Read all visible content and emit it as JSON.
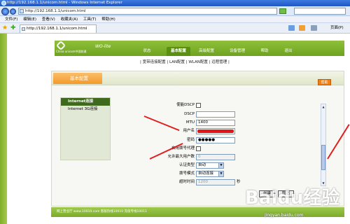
{
  "window": {
    "title": "http://192.168.1.1/unicom.html - Windows Internet Explorer"
  },
  "address": {
    "url": "http://192.168.1.1/unicom.html"
  },
  "menu": [
    "文件(F)",
    "编辑(E)",
    "查看(V)",
    "收藏夹(A)",
    "工具(T)",
    "帮助(H)"
  ],
  "tab": {
    "label": "http://192.168.1.1/unicom.html"
  },
  "toolbar": {
    "page_label": "页面(P)"
  },
  "router": {
    "brand": "China unicom中国联通",
    "product": "WO-lite",
    "nav": [
      "状态",
      "基本配置",
      "高级配置",
      "设备管理",
      "帮助",
      "退出"
    ],
    "subnav": "| 宽带连接配置 | LAN配置 | WLAN配置 | 远程管理 |",
    "section_title": "基本配置",
    "help_label": "帮助",
    "left_menu": [
      "Internet连接",
      "Internet 3G连接"
    ],
    "form": {
      "dscp_enable": "使能DSCP",
      "dscp": "DSCP",
      "mtu_label": "MTU",
      "mtu_value": "1400",
      "username_label": "用户名",
      "password_label": "密码",
      "password_value": "●●●●●",
      "proxy_enable": "启用拨号代理",
      "max_users": "允许最大用户数",
      "max_users_value": "0",
      "auth_type": "认证类型",
      "auth_value": "自动",
      "dial_mode": "拨号模式",
      "dial_value": "自动连接",
      "idle_time": "超时时间",
      "idle_value": "1200",
      "idle_unit": "秒"
    },
    "buttons": {
      "create": "创建",
      "cancel": "取消"
    },
    "footer": "网上营业厅 www.10010.com 客服热线10010 充值专线10011"
  },
  "watermark": {
    "text": "Baidu经验",
    "url": "jingyan.baidu.com"
  },
  "colors": {
    "accent": "#7fae2a",
    "title_orange": "#f29a2a",
    "annotation": "#e02020"
  }
}
